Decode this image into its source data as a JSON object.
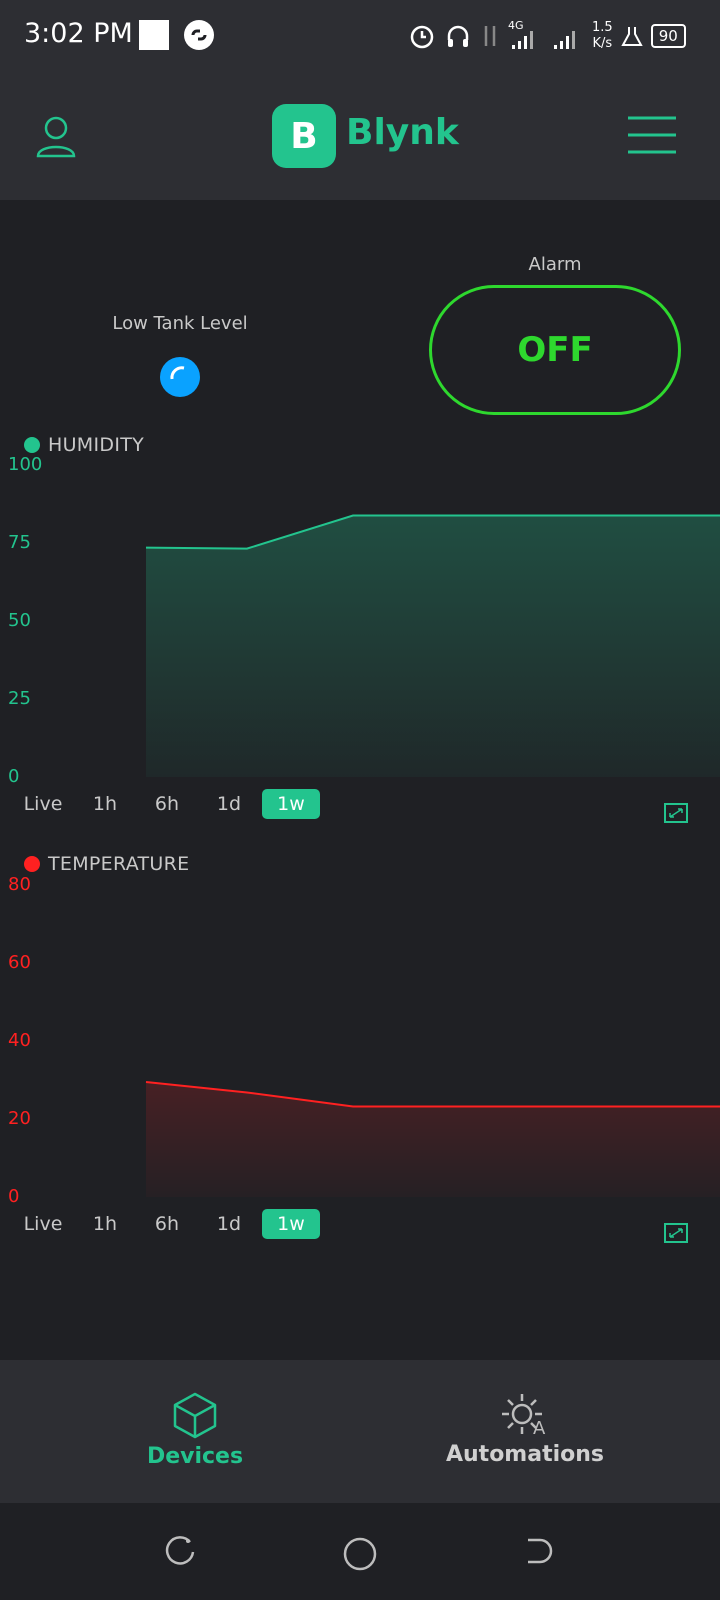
{
  "status_bar": {
    "time": "3:02 PM",
    "network_type": "4G",
    "net_speed_value": "1.5",
    "net_speed_unit": "K/s",
    "battery": "90"
  },
  "app_bar": {
    "logo_letter": "B",
    "logo_text": "Blynk",
    "accent_color": "#23c48e"
  },
  "widgets": {
    "led": {
      "label": "Low Tank Level",
      "color": "#0aa2ff"
    },
    "alarm": {
      "label": "Alarm",
      "state": "OFF",
      "color": "#2ed82e"
    }
  },
  "charts": {
    "humidity": {
      "legend": "HUMIDITY",
      "ticks": [
        "100",
        "75",
        "50",
        "25",
        "0"
      ],
      "ranges": [
        "Live",
        "1h",
        "6h",
        "1d",
        "1w"
      ],
      "active_range": "1w"
    },
    "temperature": {
      "legend": "TEMPERATURE",
      "ticks": [
        "80",
        "60",
        "40",
        "20",
        "0"
      ],
      "ranges": [
        "Live",
        "1h",
        "6h",
        "1d",
        "1w"
      ],
      "active_range": "1w"
    }
  },
  "chart_data": [
    {
      "type": "area",
      "title": "HUMIDITY",
      "color": "#23c48e",
      "ylim": [
        0,
        100
      ],
      "x": [
        0,
        1,
        2,
        3,
        4
      ],
      "series": [
        {
          "name": "HUMIDITY",
          "values": [
            73.5,
            73.2,
            83.8,
            83.8,
            83.8
          ]
        }
      ]
    },
    {
      "type": "area",
      "title": "TEMPERATURE",
      "color": "#ff2121",
      "ylim": [
        0,
        80
      ],
      "x": [
        0,
        1,
        2,
        3,
        4
      ],
      "series": [
        {
          "name": "TEMPERATURE",
          "values": [
            29.5,
            26.8,
            23.2,
            23.2,
            23.2
          ]
        }
      ]
    }
  ],
  "bottom_nav": {
    "devices": "Devices",
    "automations": "Automations",
    "automation_icon_letter": "A"
  }
}
